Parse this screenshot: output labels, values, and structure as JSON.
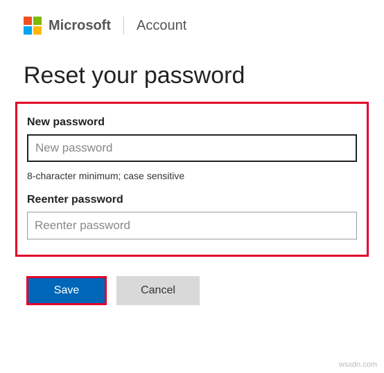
{
  "header": {
    "brand": "Microsoft",
    "section": "Account"
  },
  "page": {
    "title": "Reset your password"
  },
  "form": {
    "newPassword": {
      "label": "New password",
      "placeholder": "New password",
      "helper": "8-character minimum; case sensitive"
    },
    "reenterPassword": {
      "label": "Reenter password",
      "placeholder": "Reenter password"
    }
  },
  "buttons": {
    "save": "Save",
    "cancel": "Cancel"
  },
  "watermark": "wsxdn.com"
}
